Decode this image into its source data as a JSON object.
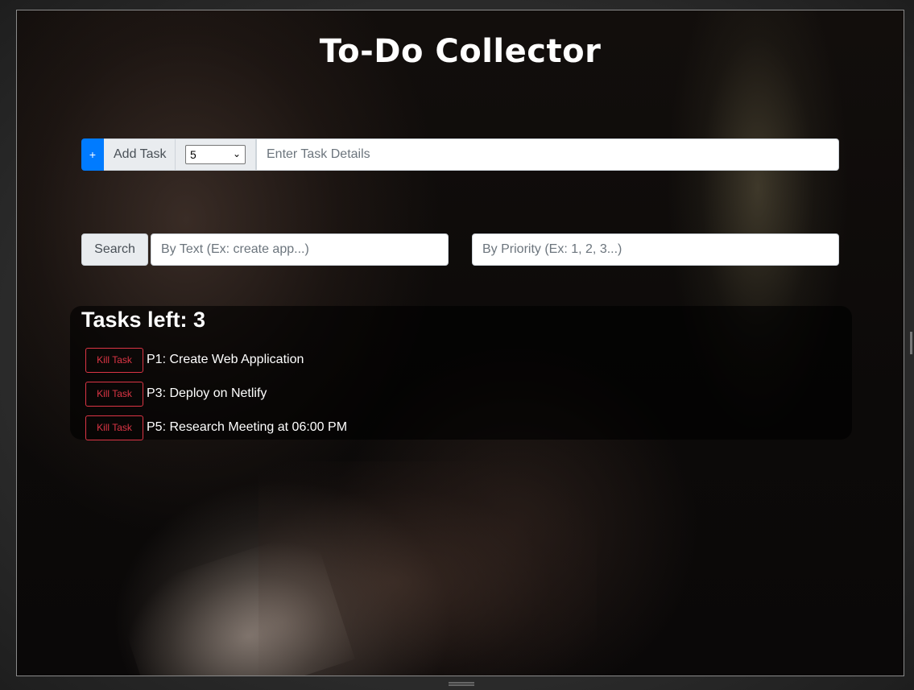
{
  "app": {
    "title": "To-Do Collector"
  },
  "add_task": {
    "plus_label": "+",
    "add_label": "Add Task",
    "priority_selected": "5",
    "details_placeholder": "Enter Task Details"
  },
  "search": {
    "button_label": "Search",
    "text_placeholder": "By Text (Ex: create app...)",
    "priority_placeholder": "By Priority (Ex: 1, 2, 3...)"
  },
  "tasks": {
    "heading": "Tasks left: 3",
    "kill_label": "Kill Task",
    "items": [
      {
        "text": "P1: Create Web Application"
      },
      {
        "text": "P3: Deploy on Netlify"
      },
      {
        "text": "P5: Research Meeting at 06:00 PM"
      }
    ]
  },
  "colors": {
    "primary": "#007bff",
    "danger": "#dc3545",
    "addon_bg": "#e9ecef"
  },
  "icons": {
    "select_chevron": "chevron-down-icon"
  }
}
